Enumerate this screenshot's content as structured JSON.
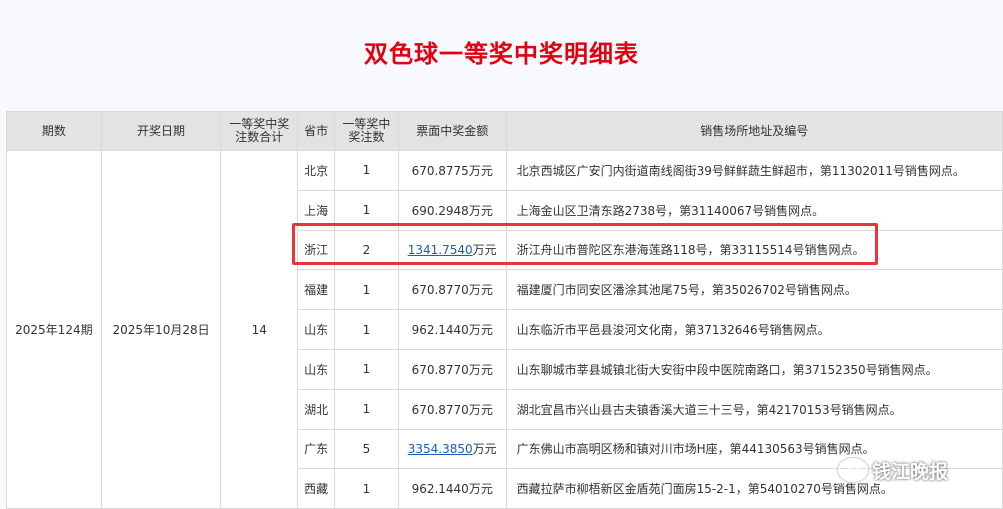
{
  "title": "双色球一等奖中奖明细表",
  "headers": {
    "period": "期数",
    "date": "开奖日期",
    "total_first": "一等奖中奖注数合计",
    "province": "省市",
    "first_count": "一等奖中奖注数",
    "ticket_amount": "票面中奖金额",
    "address": "销售场所地址及编号"
  },
  "summary": {
    "period": "2025年124期",
    "date": "2025年10月28日",
    "total_first": "14"
  },
  "rows": [
    {
      "province": "北京",
      "count": "1",
      "amount": "670.8775",
      "amount_unit": "",
      "amount_plain": "670.8775万元",
      "linked": false,
      "address": "北京西城区广安门内街道南线阁街39号鲜鲜蔬生鲜超市，第11302011号销售网点。"
    },
    {
      "province": "上海",
      "count": "1",
      "amount": "",
      "amount_unit": "",
      "amount_plain": "690.2948万元",
      "linked": false,
      "address": "上海金山区卫清东路2738号，第31140067号销售网点。"
    },
    {
      "province": "浙江",
      "count": "2",
      "amount": "1341.7540",
      "amount_unit": "万元",
      "amount_plain": "",
      "linked": true,
      "address": "浙江舟山市普陀区东港海莲路118号，第33115514号销售网点。"
    },
    {
      "province": "福建",
      "count": "1",
      "amount": "",
      "amount_unit": "",
      "amount_plain": "670.8770万元",
      "linked": false,
      "address": "福建厦门市同安区潘涂其池尾75号，第35026702号销售网点。"
    },
    {
      "province": "山东",
      "count": "1",
      "amount": "",
      "amount_unit": "",
      "amount_plain": "962.1440万元",
      "linked": false,
      "address": "山东临沂市平邑县浚河文化南，第37132646号销售网点。"
    },
    {
      "province": "山东",
      "count": "1",
      "amount": "",
      "amount_unit": "",
      "amount_plain": "670.8770万元",
      "linked": false,
      "address": "山东聊城市莘县城镇北街大安街中段中医院南路口，第37152350号销售网点。"
    },
    {
      "province": "湖北",
      "count": "1",
      "amount": "",
      "amount_unit": "",
      "amount_plain": "670.8770万元",
      "linked": false,
      "address": "湖北宜昌市兴山县古夫镇香溪大道三十三号，第42170153号销售网点。"
    },
    {
      "province": "广东",
      "count": "5",
      "amount": "3354.3850",
      "amount_unit": "万元",
      "amount_plain": "",
      "linked": true,
      "address": "广东佛山市高明区杨和镇对川市场H座，第44130563号销售网点。"
    },
    {
      "province": "西藏",
      "count": "1",
      "amount": "",
      "amount_unit": "",
      "amount_plain": "962.1440万元",
      "linked": false,
      "address": "西藏拉萨市柳梧新区金盾苑门面房15-2-1，第54010270号销售网点。"
    }
  ],
  "watermark": "钱江晚报",
  "colors": {
    "title": "#e00012",
    "header_bg": "#e3e3e3",
    "link": "#1a5fb4",
    "highlight_box": "#e8343a"
  }
}
